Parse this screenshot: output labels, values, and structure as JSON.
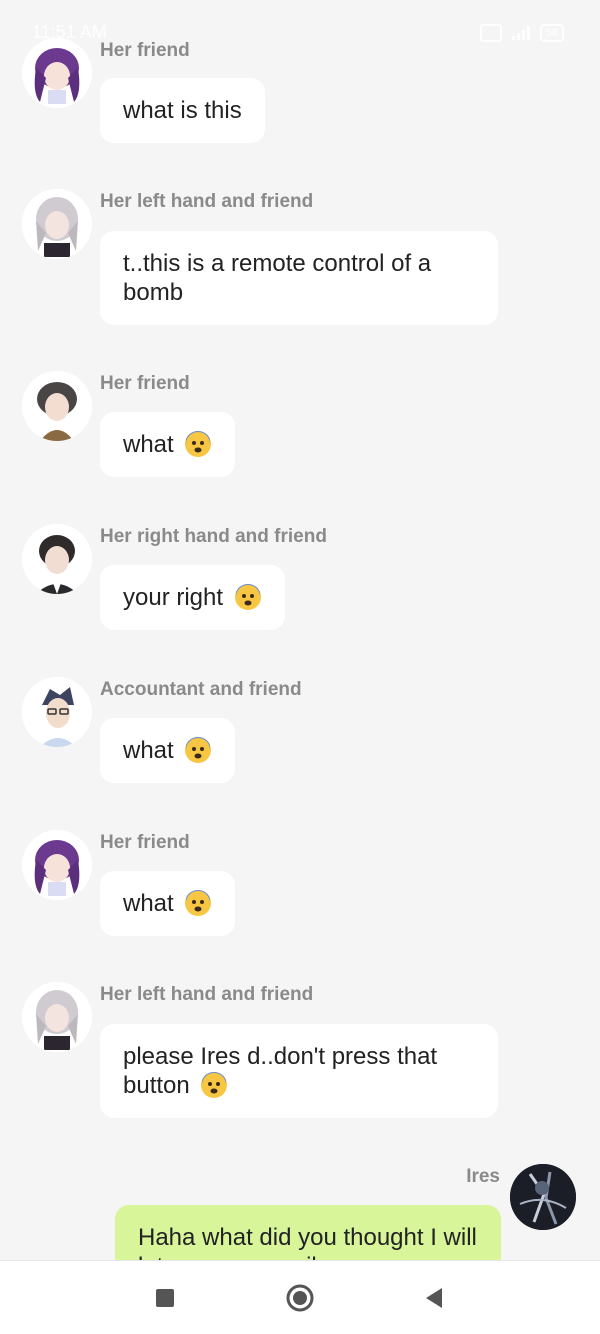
{
  "status_bar": {
    "time": "11:51 AM",
    "battery": "58"
  },
  "messages": [
    {
      "sender": "Her friend",
      "text": "what is this",
      "emoji": false,
      "avatar": "purple-hair-girl-avatar"
    },
    {
      "sender": "Her left hand and friend",
      "text": "t..this is a remote control of a bomb",
      "emoji": false,
      "avatar": "silver-hair-girl-avatar"
    },
    {
      "sender": "Her friend",
      "text": "what",
      "emoji": true,
      "avatar": "brown-hair-boy-avatar"
    },
    {
      "sender": "Her right hand and friend",
      "text": "your right",
      "emoji": true,
      "avatar": "dark-hair-man-avatar"
    },
    {
      "sender": "Accountant and friend",
      "text": "what",
      "emoji": true,
      "avatar": "glasses-man-avatar"
    },
    {
      "sender": "Her friend",
      "text": "what",
      "emoji": true,
      "avatar": "purple-hair-girl-avatar"
    },
    {
      "sender": "Her left hand and friend",
      "text": "please Ires d..don't press that button",
      "emoji": true,
      "avatar": "silver-hair-girl-avatar"
    }
  ],
  "own_message": {
    "sender": "Ires",
    "text": "Haha what did you thought I will let you press evil"
  },
  "emoji_name": "fearful-face-emoji",
  "colors": {
    "own_bubble": "#d8f59a",
    "background": "#f5f5f5"
  },
  "nav": {
    "icons": [
      "square-recents-icon",
      "circle-home-icon",
      "triangle-back-icon"
    ]
  }
}
